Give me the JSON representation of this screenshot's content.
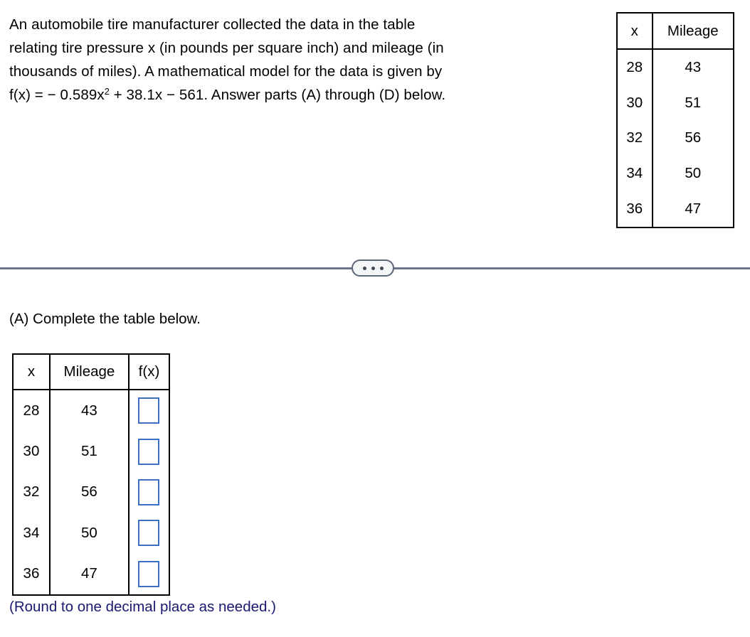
{
  "problem": {
    "lines": [
      "An automobile tire manufacturer collected the data in the table",
      "relating tire pressure x (in pounds per square inch) and mileage (in",
      "thousands of miles). A mathematical model for the data is given by"
    ],
    "formula_prefix": "f(x) = − 0.589x",
    "formula_exponent": "2",
    "formula_suffix": " + 38.1x − 561. Answer parts (A) through (D) below."
  },
  "data_table": {
    "headers": [
      "x",
      "Mileage"
    ],
    "rows": [
      [
        "28",
        "43"
      ],
      [
        "30",
        "51"
      ],
      [
        "32",
        "56"
      ],
      [
        "34",
        "50"
      ],
      [
        "36",
        "47"
      ]
    ]
  },
  "divider": {
    "ellipsis_label": "..."
  },
  "part_a": {
    "prompt": "(A) Complete the table below.",
    "headers": [
      "x",
      "Mileage",
      "f(x)"
    ],
    "rows": [
      {
        "x": "28",
        "mileage": "43",
        "fx_value": ""
      },
      {
        "x": "30",
        "mileage": "51",
        "fx_value": ""
      },
      {
        "x": "32",
        "mileage": "56",
        "fx_value": ""
      },
      {
        "x": "34",
        "mileage": "50",
        "fx_value": ""
      },
      {
        "x": "36",
        "mileage": "47",
        "fx_value": ""
      }
    ],
    "note": "(Round to one decimal place as needed.)"
  },
  "colors": {
    "input_border": "#3b6fc4",
    "note_text": "#191970",
    "divider": "#6d7688",
    "table_border": "#000000"
  }
}
